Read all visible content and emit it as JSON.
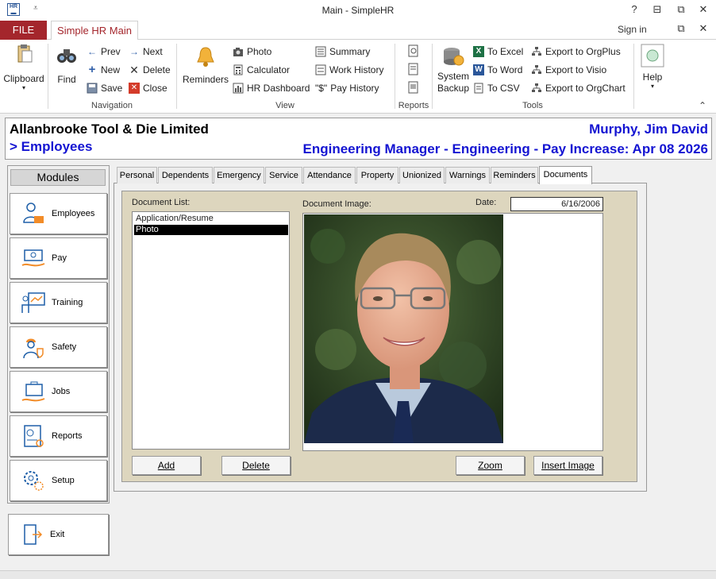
{
  "window": {
    "title": "Main - SimpleHR",
    "help": "?",
    "restore_ribbon": "⊟",
    "restore": "⧉",
    "close": "✕"
  },
  "ribbon_tabs": {
    "file": "FILE",
    "main": "Simple HR Main",
    "signin": "Sign in"
  },
  "ribbon": {
    "clipboard": "Clipboard",
    "find": "Find",
    "prev": "Prev",
    "new": "New",
    "save": "Save",
    "next": "Next",
    "delete": "Delete",
    "close": "Close",
    "navigation": "Navigation",
    "reminders": "Reminders",
    "photo": "Photo",
    "calculator": "Calculator",
    "hr_dashboard": "HR Dashboard",
    "summary": "Summary",
    "work_history": "Work History",
    "pay_history": "Pay History",
    "pay_symbol": "\"$\"",
    "view": "View",
    "reports": "Reports",
    "system": "System",
    "backup": "Backup",
    "to_excel": "To Excel",
    "to_word": "To Word",
    "to_csv": "To CSV",
    "export_orgplus": "Export to OrgPlus",
    "export_visio": "Export to Visio",
    "export_orgchart": "Export to OrgChart",
    "tools": "Tools",
    "help": "Help"
  },
  "header": {
    "company": "Allanbrooke Tool & Die Limited",
    "breadcrumb": "> Employees",
    "employee_name": "Murphy, Jim David",
    "employee_title": "Engineering Manager - Engineering - Pay Increase: Apr 08 2026"
  },
  "modules": {
    "title": "Modules",
    "items": [
      "Employees",
      "Pay",
      "Training",
      "Safety",
      "Jobs",
      "Reports",
      "Setup"
    ],
    "exit": "Exit"
  },
  "tabs": [
    "Personal",
    "Dependents",
    "Emergency",
    "Service",
    "Attendance",
    "Property",
    "Unionized",
    "Warnings",
    "Reminders",
    "Documents"
  ],
  "documents": {
    "list_label": "Document List:",
    "items": [
      "Application/Resume",
      "Photo"
    ],
    "selected_index": 1,
    "image_label": "Document Image:",
    "date_label": "Date:",
    "date_value": "6/16/2006",
    "add": "Add",
    "delete": "Delete",
    "zoom": "Zoom",
    "insert_image": "Insert Image"
  }
}
